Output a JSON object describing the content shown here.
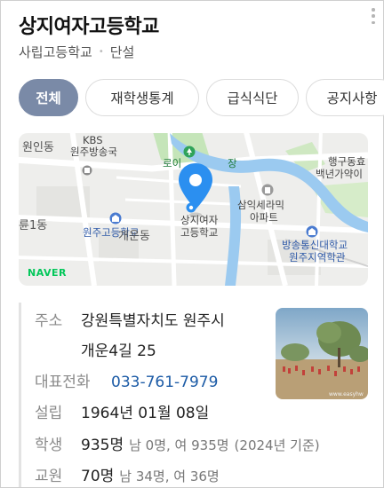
{
  "header": {
    "title": "상지여자고등학교",
    "category": "사립고등학교",
    "type": "단설"
  },
  "tabs": [
    {
      "label": "전체",
      "active": true
    },
    {
      "label": "재학생통계",
      "active": false
    },
    {
      "label": "급식식단",
      "active": false
    },
    {
      "label": "공지사항",
      "active": false
    }
  ],
  "map": {
    "labels": {
      "wonin": "원인동",
      "kbs1": "KBS",
      "kbs2": "원주방송국",
      "roi1": "로이",
      "roi2": "장",
      "haenggu1": "행구동효",
      "haenggu2": "백년가약이",
      "samik1": "삼익세라믹",
      "samik2": "아파트",
      "school1": "상지여자",
      "school2": "고등학교",
      "wonju_high": "원주고등학교",
      "gaeun": "개운동",
      "ryul": "륜1동",
      "bangsong1": "방송통신대학교",
      "bangsong2": "원주지역학관"
    },
    "brand": "NAVER",
    "colors": {
      "river": "#9bcaf0",
      "park": "#c5e5b9",
      "pin": "#2b8ff0",
      "road": "#ffffff"
    }
  },
  "info": {
    "address": {
      "label": "주소",
      "line1": "강원특별자치도 원주시",
      "line2": "개운4길 25"
    },
    "phone": {
      "label": "대표전화",
      "value": "033-761-7979"
    },
    "founded": {
      "label": "설립",
      "value": "1964년 01월 08일"
    },
    "students": {
      "label": "학생",
      "value": "935명",
      "detail": "남 0명, 여 935명",
      "note": "(2024년 기준)"
    },
    "teachers": {
      "label": "교원",
      "value": "70명",
      "detail": "남 34명, 여 36명"
    }
  },
  "photo": {
    "watermark": "www.easyhw"
  }
}
